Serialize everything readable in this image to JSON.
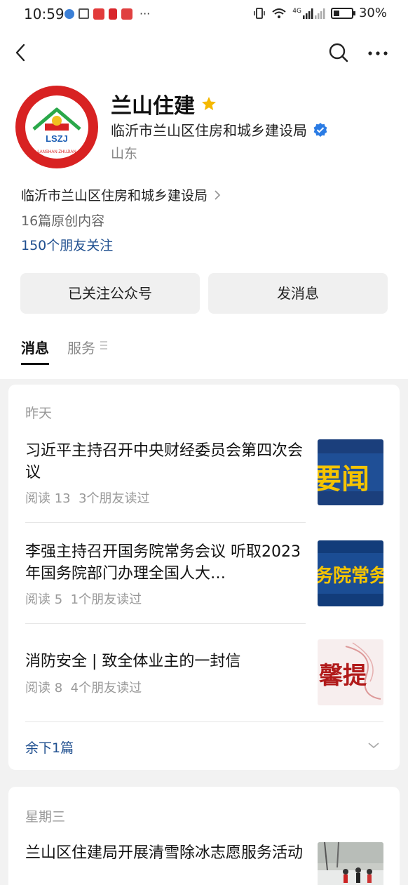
{
  "status_bar": {
    "time": "10:59",
    "battery": "30%",
    "network_tag": "4G",
    "notification_overflow": "···"
  },
  "nav": {
    "back_icon": "chevron-left-icon",
    "search_icon": "search-icon",
    "more_icon": "more-dots-icon"
  },
  "profile": {
    "logo_text": "LSZJ",
    "logo_ring_text": "LANSHAN ZHUJIAN",
    "account_name": "兰山住建",
    "org_name": "临沂市兰山区住房和城乡建设局",
    "region": "山东",
    "subject": "临沂市兰山区住房和城乡建设局",
    "original_count": "16篇原创内容",
    "friends_following": "150个朋友关注",
    "accent_blue": "#1f4f8f",
    "star_color": "#f5b800",
    "verified_color": "#2a7be4"
  },
  "actions": {
    "follow_label": "已关注公众号",
    "message_label": "发消息"
  },
  "tabs": [
    {
      "label": "消息",
      "active": true
    },
    {
      "label": "服务",
      "active": false
    }
  ],
  "feed": {
    "group1": {
      "day": "昨天",
      "articles": [
        {
          "title": "习近平主持召开中央财经委员会第四次会议",
          "reads": "阅读 13",
          "friends_read": "3个朋友读过",
          "thumb_text": "要闻"
        },
        {
          "title": "李强主持召开国务院常务会议 听取2023年国务院部门办理全国人大…",
          "reads": "阅读 5",
          "friends_read": "1个朋友读过",
          "thumb_text": "务院常务"
        },
        {
          "title": "消防安全 | 致全体业主的一封信",
          "reads": "阅读 8",
          "friends_read": "4个朋友读过",
          "thumb_text": "馨提"
        }
      ],
      "remaining": "余下1篇"
    },
    "group2": {
      "day": "星期三",
      "articles": [
        {
          "title": "兰山区住建局开展清雪除冰志愿服务活动"
        }
      ]
    }
  }
}
